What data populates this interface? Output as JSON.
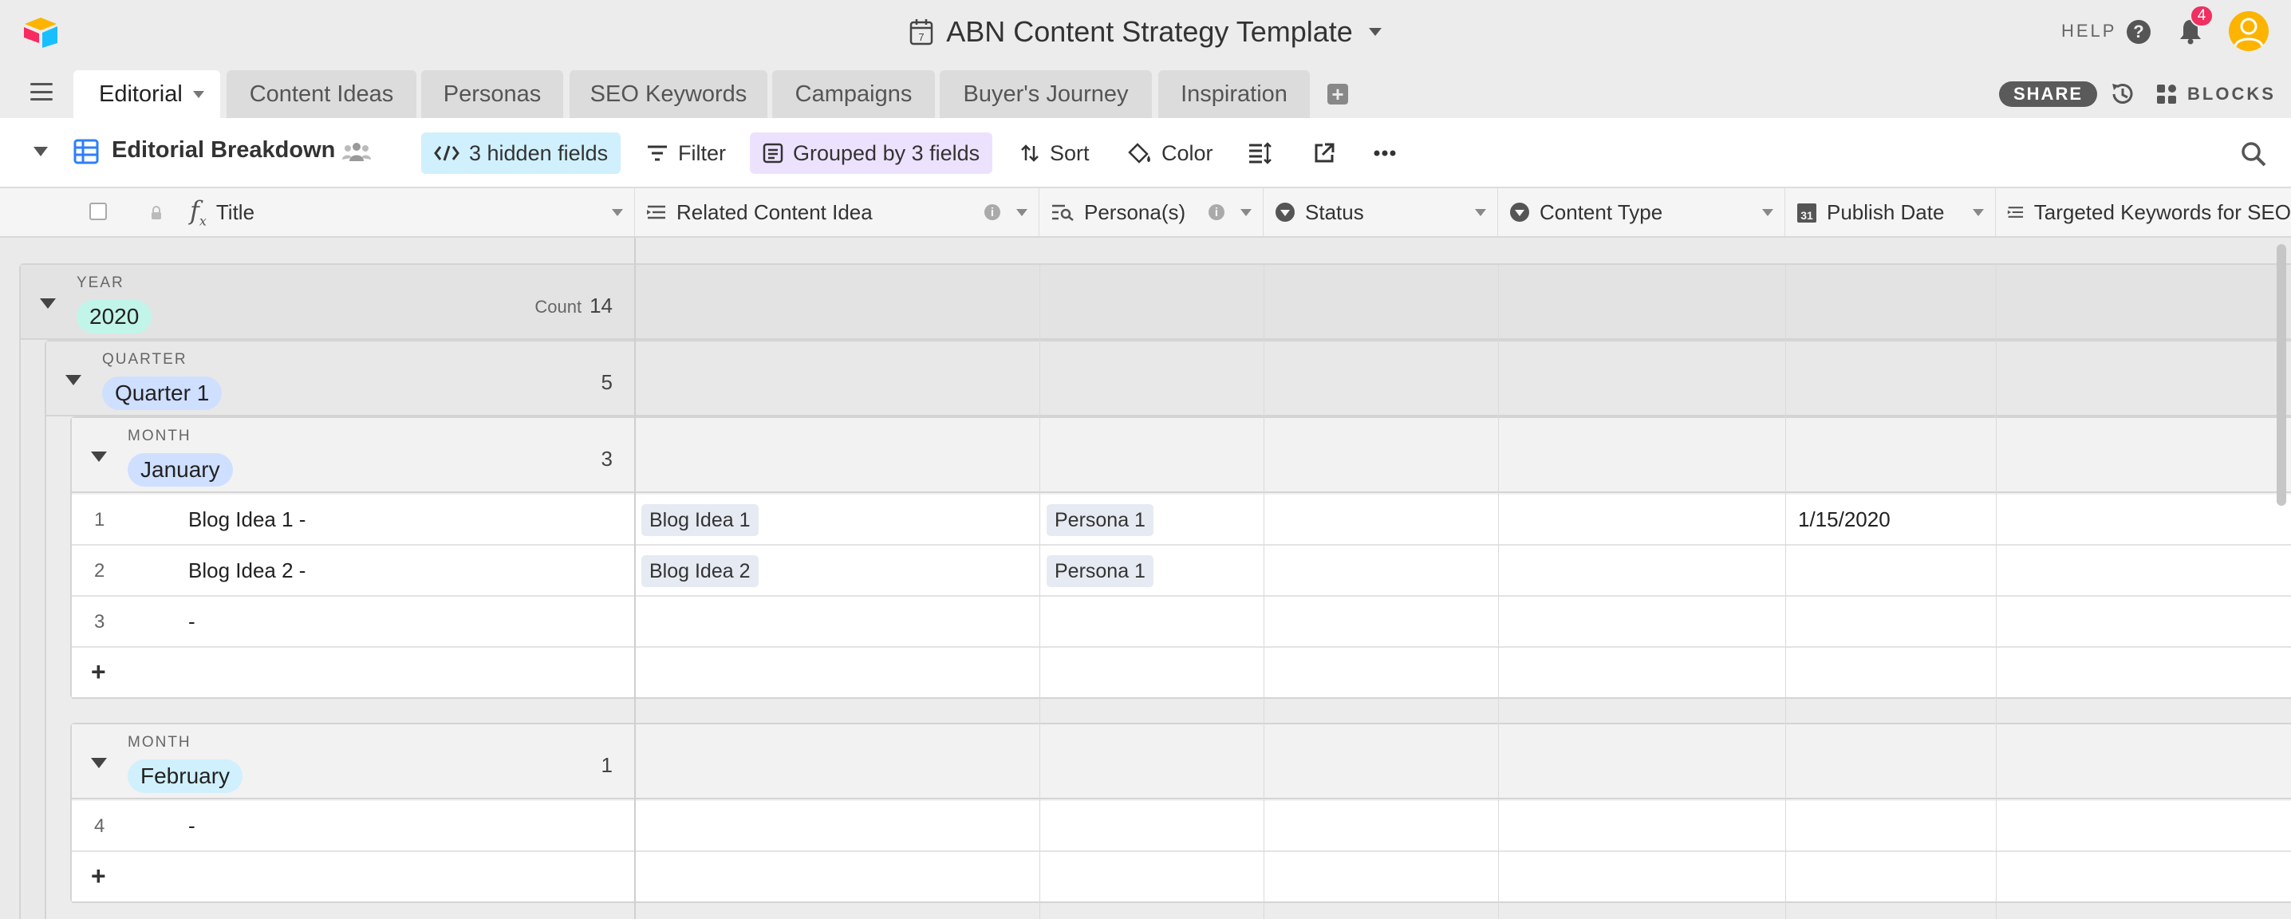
{
  "app": {
    "base_title": "ABN Content Strategy Template",
    "help_label": "HELP",
    "notification_count": "4",
    "share_label": "SHARE",
    "blocks_label": "BLOCKS"
  },
  "tabs": [
    {
      "label": "Editorial",
      "active": true
    },
    {
      "label": "Content Ideas"
    },
    {
      "label": "Personas"
    },
    {
      "label": "SEO Keywords"
    },
    {
      "label": "Campaigns"
    },
    {
      "label": "Buyer's Journey"
    },
    {
      "label": "Inspiration"
    }
  ],
  "view": {
    "name": "Editorial Breakdown",
    "hidden_fields_label": "3 hidden fields",
    "filter_label": "Filter",
    "grouped_label": "Grouped by 3 fields",
    "sort_label": "Sort",
    "color_label": "Color"
  },
  "columns": [
    {
      "label": "Title",
      "icon": "formula-icon"
    },
    {
      "label": "Related Content Idea",
      "icon": "link-icon"
    },
    {
      "label": "Persona(s)",
      "icon": "lookup-icon"
    },
    {
      "label": "Status",
      "icon": "select-icon"
    },
    {
      "label": "Content Type",
      "icon": "select-icon"
    },
    {
      "label": "Publish Date",
      "icon": "date-icon"
    },
    {
      "label": "Targeted Keywords for SEO",
      "icon": "link-icon"
    }
  ],
  "groups": {
    "year": {
      "label": "YEAR",
      "value": "2020",
      "count_label": "Count",
      "count": "14"
    },
    "quarter": {
      "label": "QUARTER",
      "value": "Quarter 1",
      "count": "5"
    },
    "month1": {
      "label": "MONTH",
      "value": "January",
      "count": "3"
    },
    "month2": {
      "label": "MONTH",
      "value": "February",
      "count": "1"
    }
  },
  "rows": [
    {
      "num": "1",
      "title": "Blog Idea 1 -",
      "content_idea": "Blog Idea 1",
      "persona": "Persona 1",
      "publish_date": "1/15/2020"
    },
    {
      "num": "2",
      "title": "Blog Idea 2 -",
      "content_idea": "Blog Idea 2",
      "persona": "Persona 1"
    },
    {
      "num": "3",
      "title": "-"
    },
    {
      "num": "4",
      "title": "-"
    }
  ],
  "add_row_label": "+",
  "colors": {
    "year_pill": "#c2f5e9",
    "quarter_pill": "#cfdfff",
    "january_pill": "#cfdfff",
    "february_pill": "#d0f0fd",
    "hidden_fields_bg": "#d0f0fd",
    "grouped_bg": "#ede2fe",
    "badge": "#ef3061",
    "avatar": "#fcb400"
  }
}
